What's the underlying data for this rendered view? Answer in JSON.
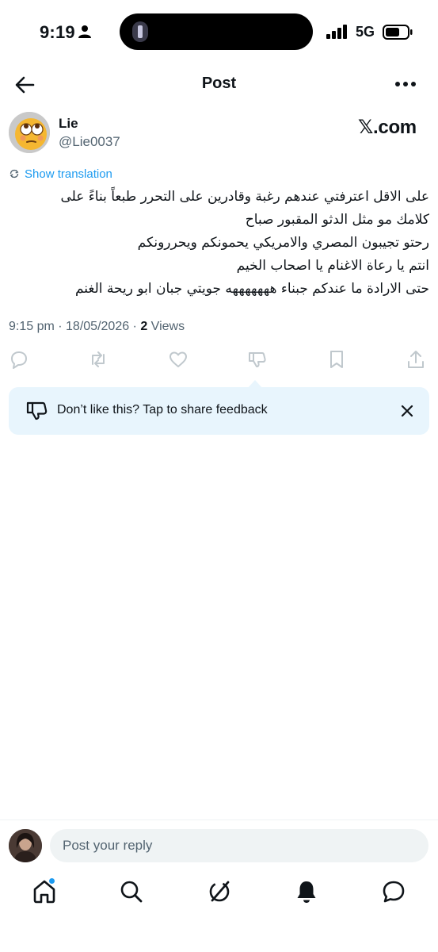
{
  "status_bar": {
    "time": "9:19",
    "network": "5G"
  },
  "header": {
    "title": "Post"
  },
  "post": {
    "author_name": "Lie",
    "author_handle": "@Lie0037",
    "brand": "𝕏.com",
    "translate_label": "Show translation",
    "lines": [
      "على الاقل اعترفتي عندهم رغبة وقادرين على التحرر طبعاً بناءً على",
      "كلامك مو مثل الدثو المقبور صباح",
      "رحتو تجيبون المصري والامريكي يحمونكم ويحررونكم",
      "انتم يا رعاة الاغنام يا اصحاب الخيم",
      "حتى الارادة ما عندكم جبناء هههههههه جويتي جبان ابو ريحة الغنم"
    ],
    "timestamp": "9:15 pm · 18/05/2026 · ",
    "views_count": "2",
    "views_label": " Views"
  },
  "feedback": {
    "text": "Don’t like this? Tap to share feedback"
  },
  "reply": {
    "placeholder": "Post your reply"
  },
  "nav": {
    "items": [
      "home-icon",
      "search-icon",
      "grok-icon",
      "notifications-icon",
      "messages-icon"
    ],
    "home_badge": true
  },
  "colors": {
    "accent": "#1d9bf0",
    "text": "#0f1419",
    "muted": "#536471",
    "feedback_bg": "#e8f5fd"
  }
}
